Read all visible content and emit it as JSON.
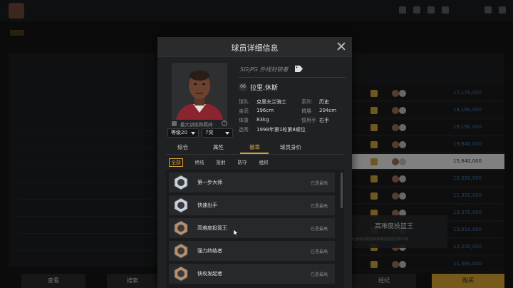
{
  "modal": {
    "title": "球员详细信息",
    "player": {
      "position": "SG|PG 外线封锁者",
      "number": "06",
      "name": "拉里.休斯",
      "mentor_label": "最大训练和羁绊",
      "level_select": "等级20",
      "breakthrough_select": "7突",
      "info": {
        "team_key": "球队",
        "team_val": "克里夫兰骑士",
        "series_key": "系列",
        "series_val": "历史",
        "height_key": "身高",
        "height_val": "196cm",
        "wingspan_key": "臂展",
        "wingspan_val": "204cm",
        "weight_key": "体重",
        "weight_val": "83kg",
        "hand_key": "惯用手",
        "hand_val": "右手",
        "draft_key": "选秀",
        "draft_val": "1998年第1轮第8顺位"
      }
    },
    "tabs": [
      "综合",
      "属性",
      "徽章",
      "球员身价"
    ],
    "active_tab": "徽章",
    "filters": [
      "全部",
      "终结",
      "投射",
      "防守",
      "组织"
    ],
    "active_filter": "全部",
    "badges": [
      {
        "name": "第一步大师",
        "level": "已是最高",
        "color": "#c9d3dc"
      },
      {
        "name": "快速出手",
        "level": "已是最高",
        "color": "#c9d3dc"
      },
      {
        "name": "高难度投篮王",
        "level": "已是最高",
        "color": "#b8906e"
      },
      {
        "name": "强力终结者",
        "level": "已是最高",
        "color": "#b8906e"
      },
      {
        "name": "快攻发起者",
        "level": "已是最高",
        "color": "#b8906e"
      }
    ]
  },
  "tooltip": {
    "title": "高难度投篮王",
    "desc": "提升运球后做各种高难度投篮的命中率"
  },
  "background": {
    "right_values": [
      "17,170,000",
      "18,180,000",
      "19,190,000",
      "19,840,000",
      "15,840,000",
      "12,550,000",
      "11,350,000",
      "13,370,000",
      "13,010,000",
      "13,200,000",
      "11,490,000"
    ],
    "bottom_buttons": [
      "查看",
      "搜索",
      "经纪",
      "购买"
    ]
  }
}
